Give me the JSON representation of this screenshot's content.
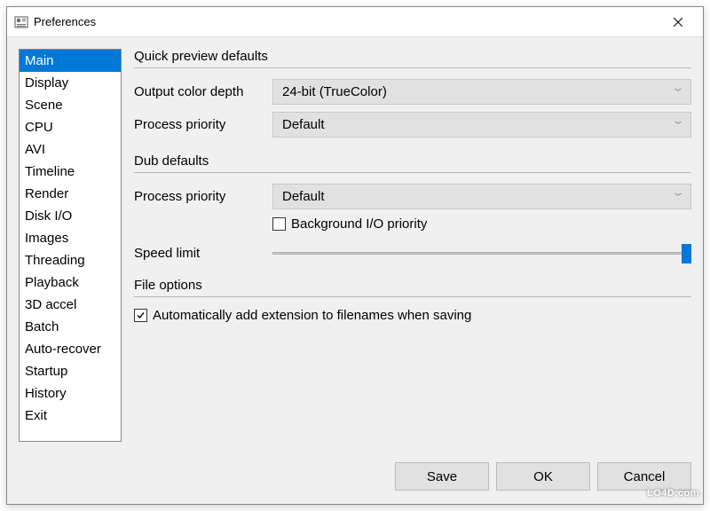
{
  "titlebar": {
    "title": "Preferences"
  },
  "sidebar": {
    "items": [
      {
        "label": "Main",
        "selected": true
      },
      {
        "label": "Display",
        "selected": false
      },
      {
        "label": "Scene",
        "selected": false
      },
      {
        "label": "CPU",
        "selected": false
      },
      {
        "label": "AVI",
        "selected": false
      },
      {
        "label": "Timeline",
        "selected": false
      },
      {
        "label": "Render",
        "selected": false
      },
      {
        "label": "Disk I/O",
        "selected": false
      },
      {
        "label": "Images",
        "selected": false
      },
      {
        "label": "Threading",
        "selected": false
      },
      {
        "label": "Playback",
        "selected": false
      },
      {
        "label": "3D accel",
        "selected": false
      },
      {
        "label": "Batch",
        "selected": false
      },
      {
        "label": "Auto-recover",
        "selected": false
      },
      {
        "label": "Startup",
        "selected": false
      },
      {
        "label": "History",
        "selected": false
      },
      {
        "label": "Exit",
        "selected": false
      }
    ]
  },
  "groups": {
    "quick_preview": {
      "title": "Quick preview defaults",
      "color_depth_label": "Output color depth",
      "color_depth_value": "24-bit (TrueColor)",
      "priority_label": "Process priority",
      "priority_value": "Default"
    },
    "dub": {
      "title": "Dub defaults",
      "priority_label": "Process priority",
      "priority_value": "Default",
      "bg_io_label": "Background I/O priority",
      "bg_io_checked": false,
      "speed_label": "Speed limit"
    },
    "file_opts": {
      "title": "File options",
      "auto_ext_label": "Automatically add extension to filenames when saving",
      "auto_ext_checked": true
    }
  },
  "buttons": {
    "save": "Save",
    "ok": "OK",
    "cancel": "Cancel"
  },
  "watermark": "LO4D.com"
}
